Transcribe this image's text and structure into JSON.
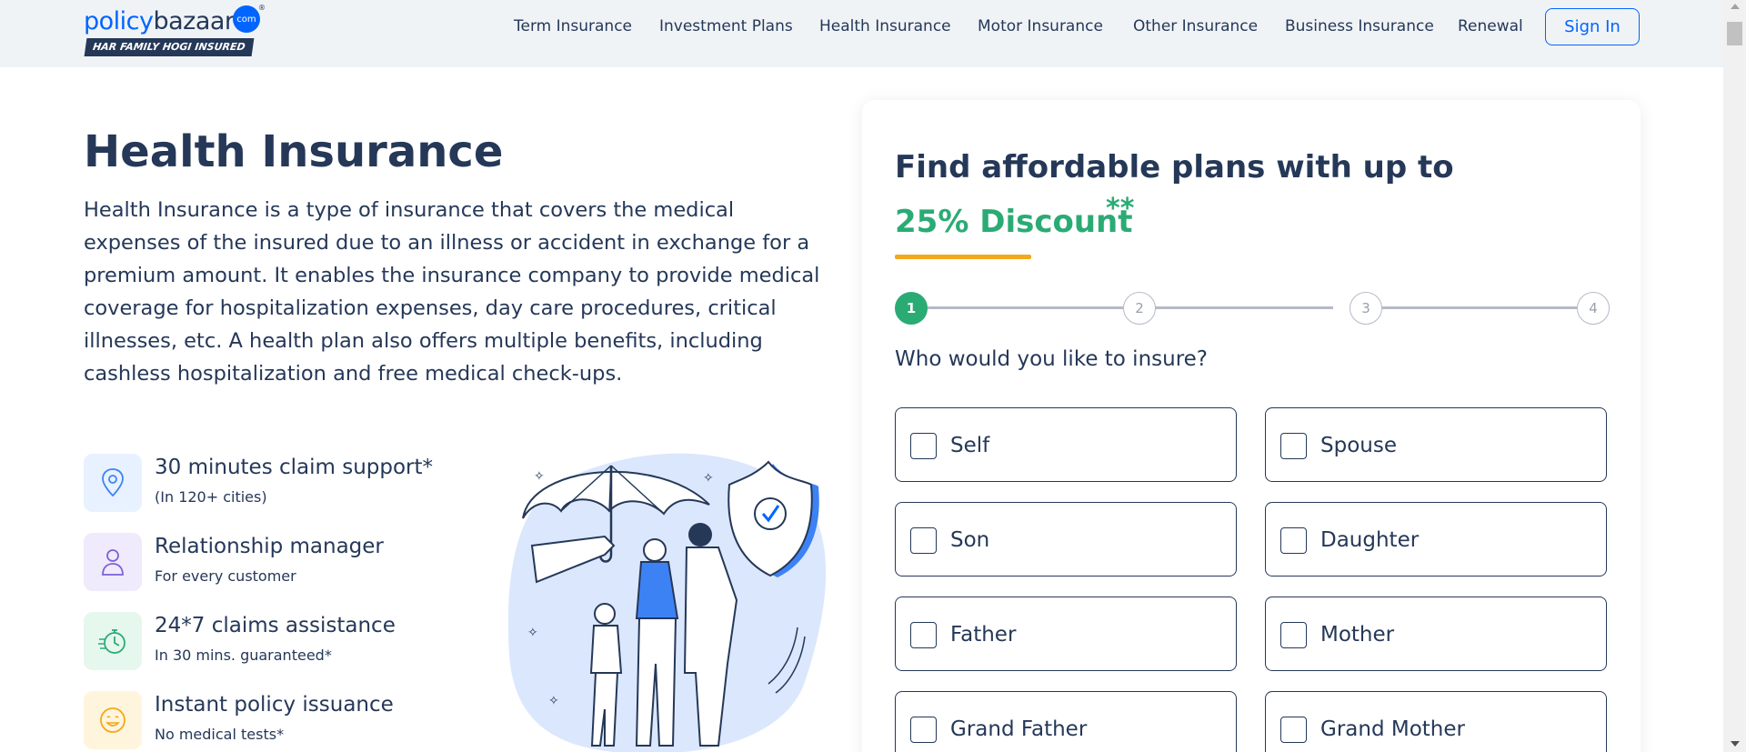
{
  "header": {
    "logo": {
      "word1": "policy",
      "word2": "bazaar",
      "badge": "com",
      "reg": "®",
      "tagline": "HAR FAMILY HOGI INSURED"
    },
    "nav": [
      {
        "label": "Term Insurance"
      },
      {
        "label": "Investment Plans"
      },
      {
        "label": "Health Insurance"
      },
      {
        "label": "Motor Insurance"
      },
      {
        "label": "Other Insurance"
      },
      {
        "label": "Business Insurance"
      },
      {
        "label": "Renewal"
      }
    ],
    "signin_label": "Sign In"
  },
  "main": {
    "title": "Health Insurance",
    "description": "Health Insurance is a type of insurance that covers the medical expenses of the insured due to an illness or accident in exchange for a premium amount. It enables the insurance company to provide medical coverage for hospitalization expenses, day care procedures, critical illnesses, etc. A health plan also offers multiple benefits, including cashless hospitalization and free medical check-ups.",
    "features": [
      {
        "title": "30 minutes claim support*",
        "subtitle": "(In 120+ cities)",
        "icon": "location-pin-icon",
        "bg": "#e8f1ff",
        "color": "#3d82f5"
      },
      {
        "title": "Relationship manager",
        "subtitle": "For every customer",
        "icon": "user-icon",
        "bg": "#efeafc",
        "color": "#7d61d8"
      },
      {
        "title": "24*7 claims assistance",
        "subtitle": "In 30 mins. guaranteed*",
        "icon": "stopwatch-icon",
        "bg": "#e6f7ee",
        "color": "#2bab74"
      },
      {
        "title": "Instant policy issuance",
        "subtitle": "No medical tests*",
        "icon": "smiley-icon",
        "bg": "#fff5dc",
        "color": "#f4a81d"
      }
    ]
  },
  "form": {
    "title": "Find affordable plans with up to",
    "discount": "25% Discount",
    "discount_mark": "**",
    "steps": [
      "1",
      "2",
      "3",
      "4"
    ],
    "active_step": 1,
    "question": "Who would you like to insure?",
    "options": [
      {
        "label": "Self",
        "checked": false
      },
      {
        "label": "Spouse",
        "checked": false
      },
      {
        "label": "Son",
        "checked": false
      },
      {
        "label": "Daughter",
        "checked": false
      },
      {
        "label": "Father",
        "checked": false
      },
      {
        "label": "Mother",
        "checked": false
      },
      {
        "label": "Grand Father",
        "checked": false
      },
      {
        "label": "Grand Mother",
        "checked": false
      }
    ]
  },
  "colors": {
    "navy": "#253858",
    "brand_blue": "#0065ff",
    "green": "#2bab74",
    "accent_orange": "#f4a81d"
  }
}
